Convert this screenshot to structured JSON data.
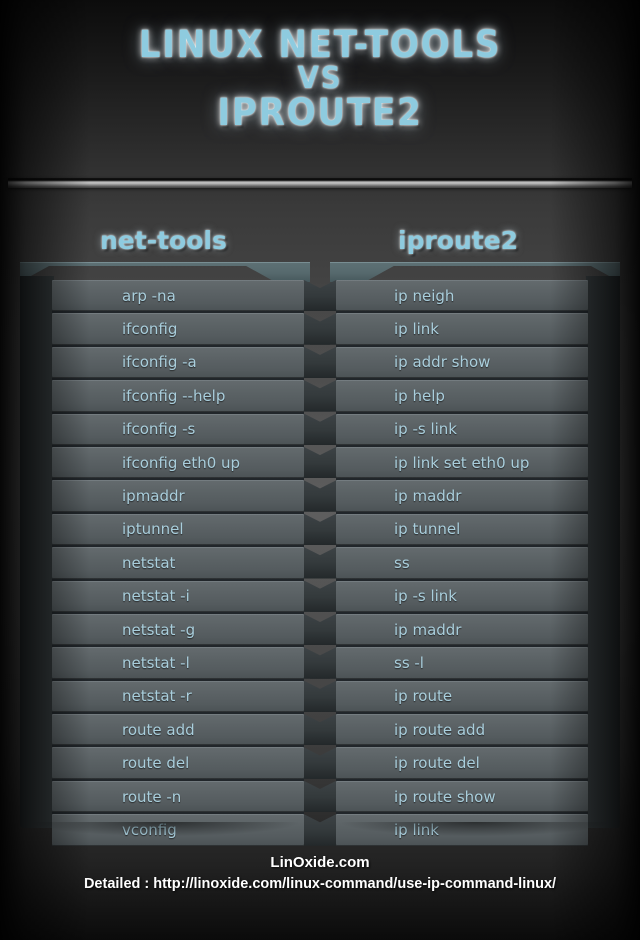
{
  "title": {
    "line1": "LINUX NET-TOOLS",
    "line2": "VS",
    "line3": "IPROUTE2"
  },
  "colors": {
    "accent": "#8ecbdf",
    "command_text": "#a9cedc",
    "row_bg": "#5b6265",
    "box_side": "#2c3133",
    "footer_text": "#ffffff"
  },
  "columns": [
    {
      "header": "net-tools",
      "items": [
        "arp -na",
        "ifconfig",
        "ifconfig -a",
        "ifconfig --help",
        "ifconfig -s",
        "ifconfig eth0 up",
        "ipmaddr",
        "iptunnel",
        "netstat",
        "netstat -i",
        "netstat  -g",
        "netstat -l",
        "netstat -r",
        "route add",
        "route del",
        "route -n",
        "vconfig"
      ]
    },
    {
      "header": "iproute2",
      "items": [
        "ip neigh",
        "ip link",
        "ip addr show",
        "ip help",
        "ip -s link",
        "ip link set eth0 up",
        "ip maddr",
        "ip tunnel",
        "ss",
        "ip -s link",
        "ip maddr",
        "ss -l",
        "ip route",
        "ip route add",
        "ip route del",
        "ip route show",
        "ip link"
      ]
    }
  ],
  "footer": {
    "brand": "LinOxide.com",
    "detail": "Detailed : http://linoxide.com/linux-command/use-ip-command-linux/"
  }
}
